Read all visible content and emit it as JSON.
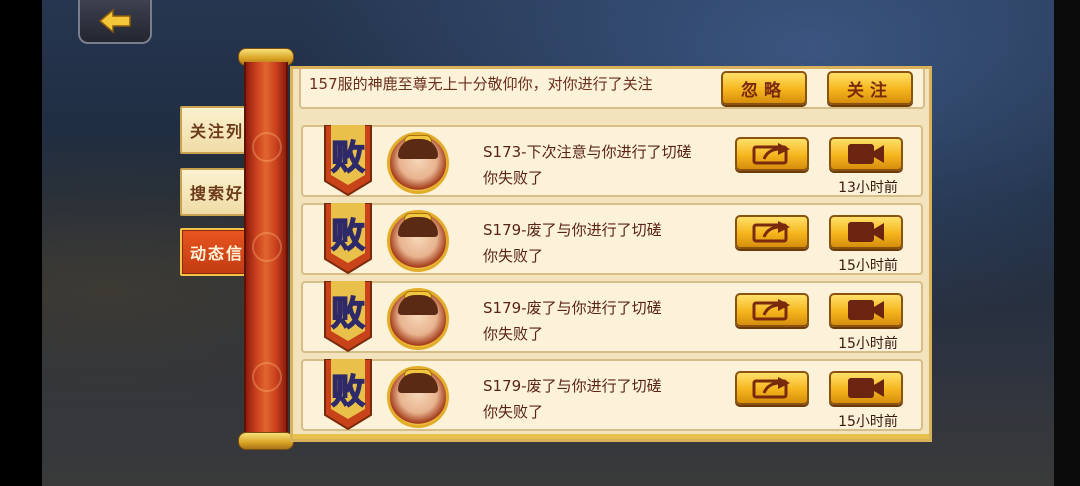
{
  "nav": {
    "back_icon": "back-arrow-icon"
  },
  "tabs": [
    {
      "label": "关注列表",
      "active": false
    },
    {
      "label": "搜索好友",
      "active": false
    },
    {
      "label": "动态信息",
      "active": true
    }
  ],
  "partial_row": {
    "message": "157服的神鹿至尊无上十分敬仰你，对你进行了关注",
    "ignore_label": "忽略",
    "follow_label": "关注"
  },
  "feed": [
    {
      "result_badge": "败",
      "line1": "S173-下次注意与你进行了切磋",
      "line2": "你失败了",
      "time": "13小时前",
      "share_icon": "share-icon",
      "replay_icon": "video-camera-icon"
    },
    {
      "result_badge": "败",
      "line1": "S179-废了与你进行了切磋",
      "line2": "你失败了",
      "time": "15小时前",
      "share_icon": "share-icon",
      "replay_icon": "video-camera-icon"
    },
    {
      "result_badge": "败",
      "line1": "S179-废了与你进行了切磋",
      "line2": "你失败了",
      "time": "15小时前",
      "share_icon": "share-icon",
      "replay_icon": "video-camera-icon"
    },
    {
      "result_badge": "败",
      "line1": "S179-废了与你进行了切磋",
      "line2": "你失败了",
      "time": "15小时前",
      "share_icon": "share-icon",
      "replay_icon": "video-camera-icon"
    }
  ],
  "colors": {
    "panel_bg": "#f2e3bd",
    "row_bg": "#fbf2d9",
    "gold_button": "#f5b51c",
    "active_tab": "#d8461a",
    "text_dark_red": "#5a2318"
  }
}
